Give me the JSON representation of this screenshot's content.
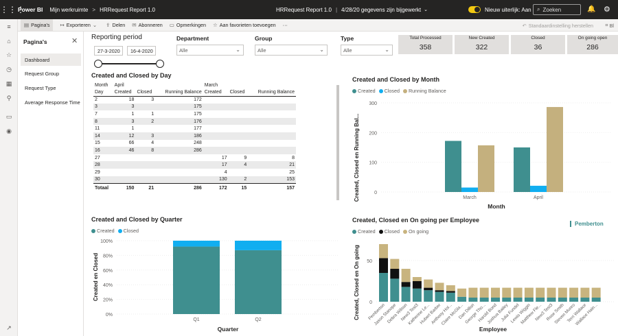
{
  "header": {
    "brand": "Power BI",
    "workspace": "Mijn werkruimte",
    "breadcrumb_separator": ">",
    "report": "HRRequest Report 1.0",
    "center_title": "HRRequest Report 1.0",
    "center_divider": "|",
    "data_updated": "4/28/20 gegevens zijn bijgewerkt",
    "new_look_label": "Nieuw uiterlijk: Aan",
    "search_placeholder": "Zoeken"
  },
  "toolbar": {
    "pages_label": "Pagina's",
    "export_label": "Exporteren",
    "share_label": "Delen",
    "subscribe_label": "Abonneren",
    "comments_label": "Opmerkingen",
    "favorite_label": "Aan favorieten toevoegen",
    "more_label": "···",
    "reset_label": "Standaardinstelling herstellen",
    "bookmarks_label": "Bl"
  },
  "pages_pane": {
    "title": "Pagina's",
    "items": [
      "Dashboard",
      "Request Group",
      "Request Type",
      "Average Response Time"
    ],
    "active_index": 0
  },
  "filters": {
    "reporting_period_label": "Reporting period",
    "date_start": "27-3-2020",
    "date_end": "16-4-2020",
    "department_label": "Department",
    "department_value": "Alle",
    "group_label": "Group",
    "group_value": "Alle",
    "type_label": "Type",
    "type_value": "Alle"
  },
  "cards": [
    {
      "title": "Total Processed",
      "value": "358"
    },
    {
      "title": "New Created",
      "value": "322"
    },
    {
      "title": "Closed",
      "value": "36"
    },
    {
      "title": "On going open",
      "value": "286"
    }
  ],
  "matrix": {
    "title": "Created and Closed by Day",
    "header1": [
      "Month",
      "April",
      "",
      "",
      "March",
      "",
      ""
    ],
    "header2": [
      "Day",
      "Created",
      "Closed",
      "Running Balance",
      "Created",
      "Closed",
      "Running Balance"
    ],
    "rows": [
      [
        "2",
        "18",
        "3",
        "172",
        "",
        "",
        ""
      ],
      [
        "3",
        "3",
        "",
        "175",
        "",
        "",
        ""
      ],
      [
        "7",
        "1",
        "1",
        "175",
        "",
        "",
        ""
      ],
      [
        "8",
        "3",
        "2",
        "176",
        "",
        "",
        ""
      ],
      [
        "11",
        "1",
        "",
        "177",
        "",
        "",
        ""
      ],
      [
        "14",
        "12",
        "3",
        "186",
        "",
        "",
        ""
      ],
      [
        "15",
        "66",
        "4",
        "248",
        "",
        "",
        ""
      ],
      [
        "16",
        "46",
        "8",
        "286",
        "",
        "",
        ""
      ],
      [
        "27",
        "",
        "",
        "",
        "17",
        "9",
        "8"
      ],
      [
        "28",
        "",
        "",
        "",
        "17",
        "4",
        "21"
      ],
      [
        "29",
        "",
        "",
        "",
        "4",
        "",
        "25"
      ],
      [
        "30",
        "",
        "",
        "",
        "130",
        "2",
        "153"
      ]
    ],
    "total": [
      "Totaal",
      "150",
      "21",
      "286",
      "172",
      "15",
      "157"
    ]
  },
  "colors": {
    "created": "#3f8f8f",
    "closed": "#11aef0",
    "running": "#c4b07e",
    "ongoing": "#c8b47f",
    "black": "#111111",
    "header_bg": "#252423",
    "accent_yellow": "#f2c811"
  },
  "chart_month": {
    "title": "Created and Closed by Month",
    "ylabel": "Created, Closed en Running Bal...",
    "xlabel": "Month",
    "legend": [
      "Created",
      "Closed",
      "Running Balance"
    ],
    "y_ticks": [
      "0",
      "100",
      "200",
      "300"
    ]
  },
  "chart_quarter": {
    "title": "Created and Closed by Quarter",
    "ylabel": "Created en Closed",
    "xlabel": "Quarter",
    "legend": [
      "Created",
      "Closed"
    ],
    "y_ticks": [
      "0%",
      "20%",
      "40%",
      "60%",
      "80%",
      "100%"
    ]
  },
  "chart_employee": {
    "title": "Created, Closed en On going per Employee",
    "ylabel": "Created, Closed en On going",
    "xlabel": "Employee",
    "legend": [
      "Created",
      "Closed",
      "On going"
    ],
    "y_ticks": [
      "0",
      "50"
    ],
    "highlight_label": "Pemberton"
  },
  "chart_data": [
    {
      "type": "bar",
      "title": "Created and Closed by Month",
      "xlabel": "Month",
      "ylabel": "Created, Closed en Running Bal...",
      "categories": [
        "March",
        "April"
      ],
      "series": [
        {
          "name": "Created",
          "values": [
            172,
            150
          ]
        },
        {
          "name": "Closed",
          "values": [
            15,
            21
          ]
        },
        {
          "name": "Running Balance",
          "values": [
            157,
            286
          ]
        }
      ],
      "ylim": [
        0,
        300
      ]
    },
    {
      "type": "bar",
      "title": "Created and Closed by Quarter",
      "xlabel": "Quarter",
      "ylabel": "Created en Closed",
      "categories": [
        "Q1",
        "Q2"
      ],
      "series": [
        {
          "name": "Created",
          "values": [
            92,
            87
          ]
        },
        {
          "name": "Closed",
          "values": [
            8,
            13
          ]
        }
      ],
      "ylim": [
        0,
        100
      ]
    },
    {
      "type": "bar",
      "title": "Created, Closed en On going per Employee",
      "xlabel": "Employee",
      "ylabel": "Created, Closed en On going",
      "categories": [
        "Pemberton",
        "Jason Stanope",
        "Debra Wilson",
        "New3 Test3",
        "Katherine Le...",
        "Hubert Barber",
        "Anthony Hol...",
        "Claire McGla...",
        "Dan Dillon",
        "George Tho...",
        "Harold Bond",
        "Joshua Bailey",
        "Julia Fundel",
        "Lewis Wiggin",
        "Matthew Fle...",
        "New3 Test3",
        "Rose Smith",
        "Steven Munro",
        "Terri Wallace",
        "Wallace Hain..."
      ],
      "series": [
        {
          "name": "Created",
          "values": [
            35,
            28,
            18,
            16,
            14,
            12,
            11,
            6,
            5,
            5,
            5,
            5,
            5,
            5,
            5,
            5,
            5,
            5,
            5,
            5
          ]
        },
        {
          "name": "Closed",
          "values": [
            18,
            12,
            6,
            9,
            3,
            2,
            2,
            0,
            0,
            0,
            0,
            0,
            0,
            0,
            0,
            0,
            0,
            0,
            0,
            0
          ]
        },
        {
          "name": "On going",
          "values": [
            17,
            12,
            16,
            5,
            10,
            9,
            7,
            10,
            12,
            12,
            12,
            12,
            12,
            12,
            12,
            12,
            12,
            12,
            12,
            12
          ]
        }
      ],
      "ylim": [
        0,
        75
      ]
    }
  ]
}
